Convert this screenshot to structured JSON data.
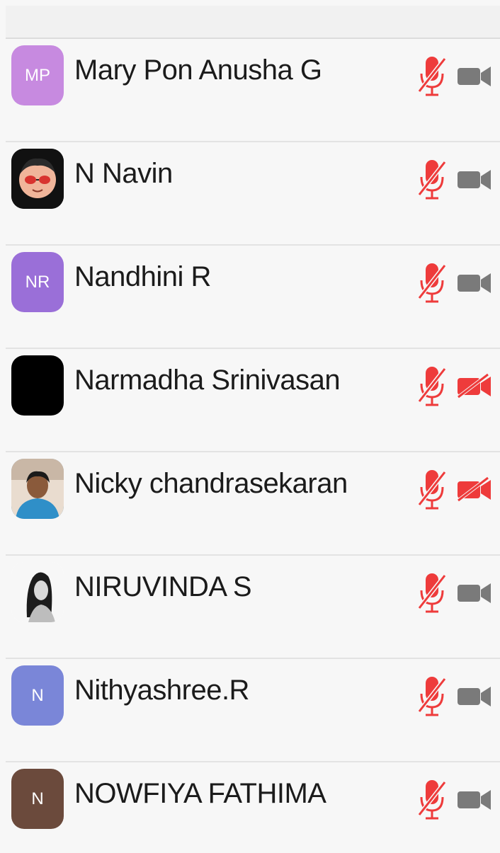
{
  "top_bar": {
    "partial_text": "",
    "background": "#f1f1f1"
  },
  "colors": {
    "muted_red": "#ee3b3b",
    "camera_gray": "#7a7a7a",
    "divider": "#e3e3e3",
    "row_background": "#f7f7f7"
  },
  "participants": [
    {
      "name": "Mary Pon Anusha G",
      "avatar": {
        "type": "initials",
        "initials": "MP",
        "color": "#c78ae0"
      },
      "mic": "muted",
      "video": "off-gray"
    },
    {
      "name": "N Navin",
      "avatar": {
        "type": "photo",
        "icon": "cartoon-face-with-sunglasses",
        "color": "#111111"
      },
      "mic": "muted",
      "video": "off-gray"
    },
    {
      "name": "Nandhini R",
      "avatar": {
        "type": "initials",
        "initials": "NR",
        "color": "#9a6fd8"
      },
      "mic": "muted",
      "video": "off-gray"
    },
    {
      "name": "Narmadha Srinivasan",
      "avatar": {
        "type": "solid",
        "color": "#000000"
      },
      "mic": "muted",
      "video": "off-red"
    },
    {
      "name": "Nicky chandrasekaran",
      "avatar": {
        "type": "photo",
        "icon": "person-photo",
        "color": "#2f7fb5"
      },
      "mic": "muted",
      "video": "off-red"
    },
    {
      "name": "NIRUVINDA S",
      "avatar": {
        "type": "photo",
        "icon": "bw-portrait",
        "color": "#ffffff"
      },
      "mic": "muted",
      "video": "off-gray"
    },
    {
      "name": "Nithyashree.R",
      "avatar": {
        "type": "initials",
        "initials": "N",
        "color": "#7a86d8"
      },
      "mic": "muted",
      "video": "off-gray"
    },
    {
      "name": "NOWFIYA FATHIMA",
      "avatar": {
        "type": "initials",
        "initials": "N",
        "color": "#6b4a3c"
      },
      "mic": "muted",
      "video": "off-gray"
    }
  ]
}
